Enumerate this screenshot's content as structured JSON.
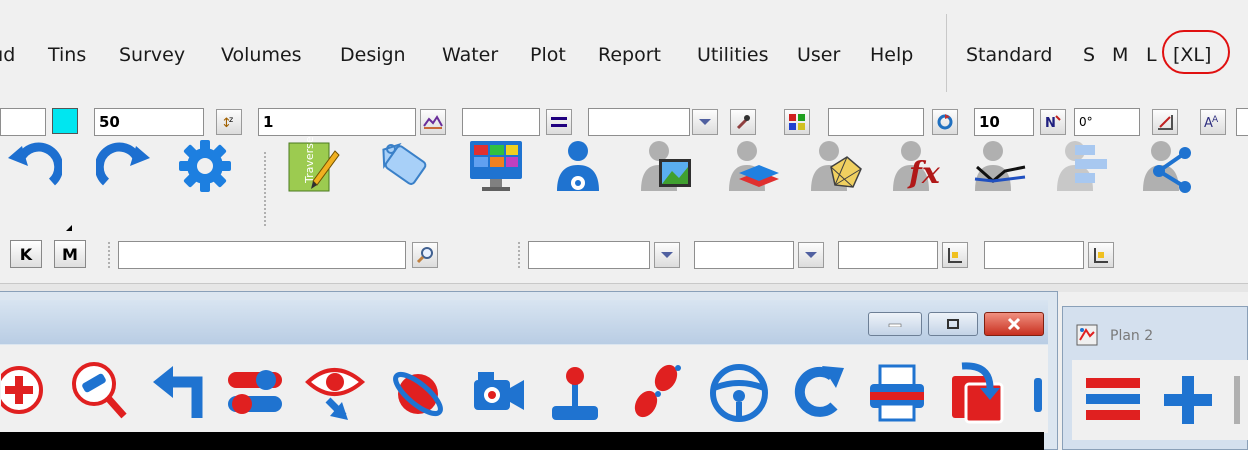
{
  "menubar": {
    "items": [
      "ıd",
      "Tins",
      "Survey",
      "Volumes",
      "Design",
      "Water",
      "Plot",
      "Report",
      "Utilities",
      "User",
      "Help"
    ],
    "size_label": "Standard",
    "size_options": [
      "S",
      "M",
      "L",
      "[XL]"
    ],
    "highlight_color": "#e01010"
  },
  "toolbar1": {
    "color_swatch": "#00e6f0",
    "field_a": "50",
    "field_b": "1",
    "field_c": "10",
    "field_d": "0°"
  },
  "toolbar3": {
    "k_label": "K",
    "m_label": "M",
    "search_value": ""
  },
  "window_main": {
    "title": ""
  },
  "window_plan": {
    "title": "Plan 2"
  }
}
